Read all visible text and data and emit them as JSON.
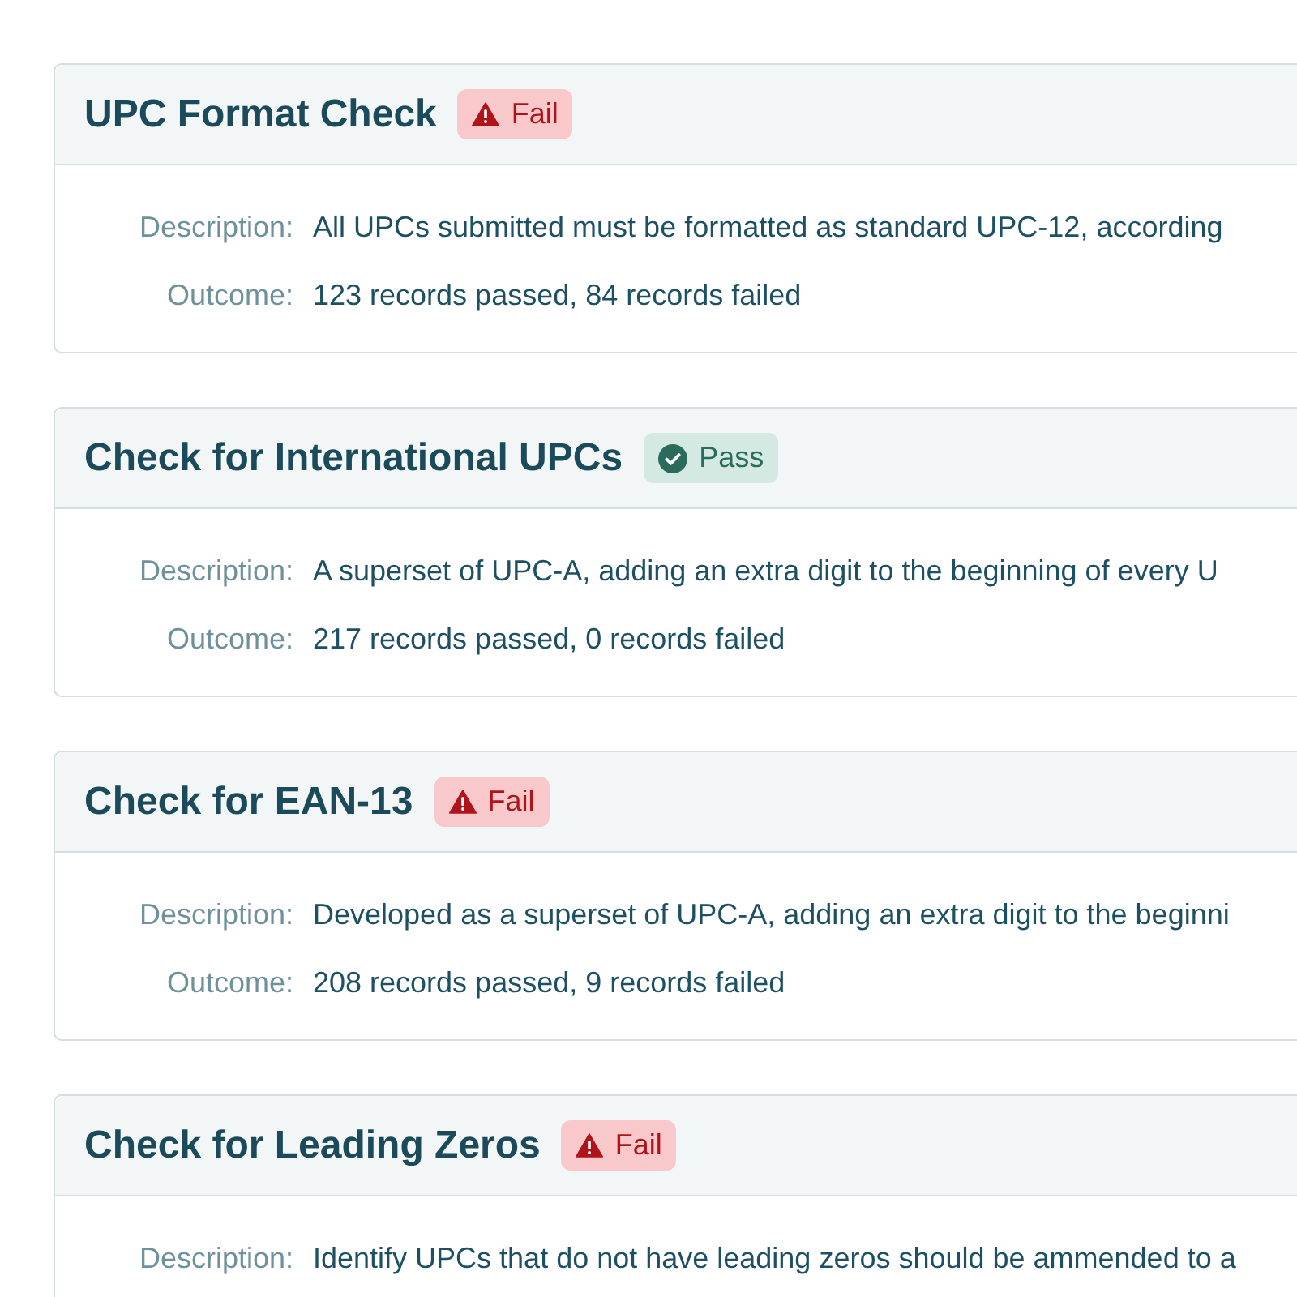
{
  "checks": [
    {
      "title": "UPC Format Check",
      "status": {
        "kind": "fail",
        "label": "Fail"
      },
      "fields": [
        {
          "label": "Description:",
          "value": "All UPCs submitted must be formatted as standard UPC-12, according"
        },
        {
          "label": "Outcome:",
          "value": "123 records passed, 84 records failed"
        }
      ]
    },
    {
      "title": "Check for International UPCs",
      "status": {
        "kind": "pass",
        "label": "Pass"
      },
      "fields": [
        {
          "label": "Description:",
          "value": "A superset of UPC-A, adding an extra digit to the beginning of every U"
        },
        {
          "label": "Outcome:",
          "value": "217 records passed, 0 records failed"
        }
      ]
    },
    {
      "title": "Check for EAN-13",
      "status": {
        "kind": "fail",
        "label": "Fail"
      },
      "fields": [
        {
          "label": "Description:",
          "value": "Developed as a superset of UPC-A, adding an extra digit to the beginni"
        },
        {
          "label": "Outcome:",
          "value": "208 records passed, 9 records failed"
        }
      ]
    },
    {
      "title": "Check for Leading Zeros",
      "status": {
        "kind": "fail",
        "label": "Fail"
      },
      "fields": [
        {
          "label": "Description:",
          "value": "Identify UPCs that do not have leading zeros should be ammended to a"
        }
      ]
    }
  ]
}
